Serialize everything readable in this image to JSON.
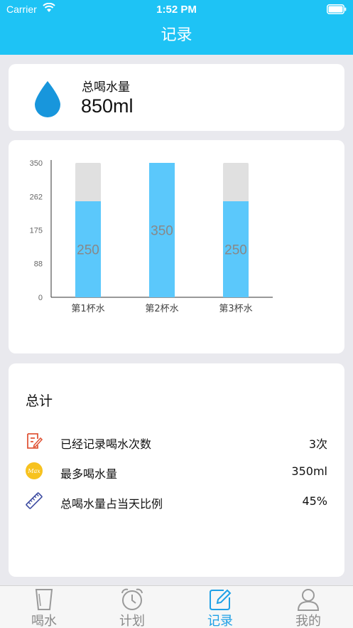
{
  "status_bar": {
    "carrier": "Carrier",
    "time": "1:52 PM"
  },
  "nav": {
    "title": "记录"
  },
  "total_card": {
    "label": "总喝水量",
    "value": "850ml",
    "icon": "water-drop-icon"
  },
  "chart_data": {
    "type": "bar",
    "categories": [
      "第1杯水",
      "第2杯水",
      "第3杯水"
    ],
    "values": [
      250,
      350,
      250
    ],
    "data_labels": [
      "250",
      "350",
      "250"
    ],
    "ylim": [
      0,
      350
    ],
    "yticks": [
      "0",
      "88",
      "175",
      "262",
      "350"
    ],
    "background_value": 350,
    "bar_color": "#5bc8fb",
    "background_bar_color": "#e0e0e0",
    "grid": false
  },
  "summary": {
    "title": "总计",
    "stats": [
      {
        "icon": "edit-note-icon",
        "label": "已经记录喝水次数",
        "value": "3次"
      },
      {
        "icon": "max-badge-icon",
        "icon_text": "Max",
        "label": "最多喝水量",
        "value": "350ml"
      },
      {
        "icon": "ruler-icon",
        "label": "总喝水量占当天比例",
        "value": "45%"
      }
    ]
  },
  "tabs": [
    {
      "label": "喝水",
      "icon": "cup-icon",
      "active": false
    },
    {
      "label": "计划",
      "icon": "alarm-clock-icon",
      "active": false
    },
    {
      "label": "记录",
      "icon": "record-edit-icon",
      "active": true
    },
    {
      "label": "我的",
      "icon": "person-icon",
      "active": false
    }
  ],
  "colors": {
    "primary": "#1ec3f5",
    "tab_active": "#1ea0e6",
    "tab_inactive": "#8a8a8a"
  }
}
